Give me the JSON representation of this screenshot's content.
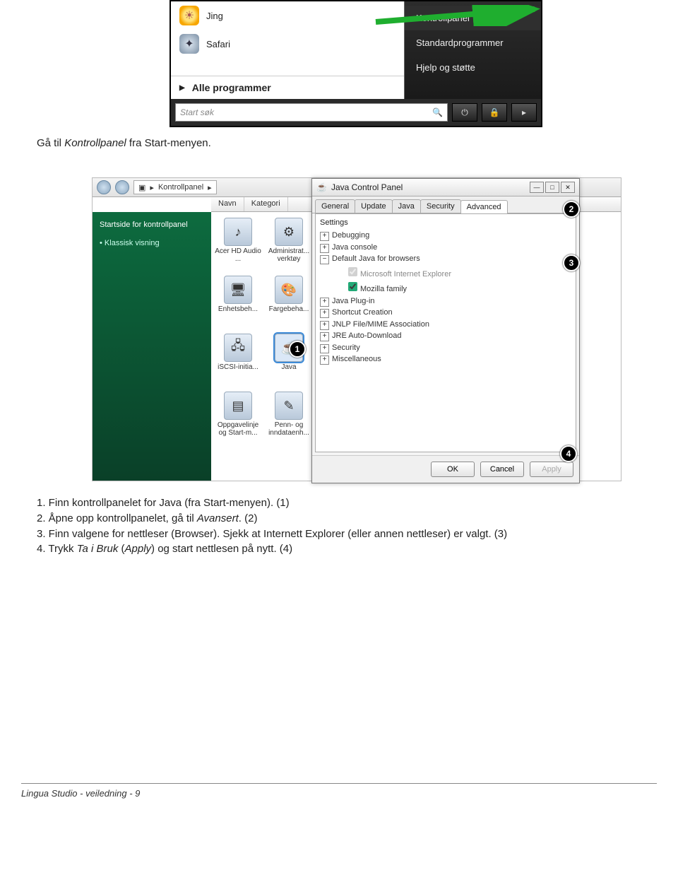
{
  "startmenu": {
    "left_items": [
      {
        "label": "Jing"
      },
      {
        "label": "Safari"
      }
    ],
    "all_programs": "Alle programmer",
    "right_items": [
      "Kontrollpanel",
      "Standardprogrammer",
      "Hjelp og støtte"
    ],
    "search_placeholder": "Start søk"
  },
  "caption1_pre": "Gå til ",
  "caption1_em": "Kontrollpanel",
  "caption1_post": " fra Start-menyen.",
  "cp": {
    "breadcrumb": "Kontrollpanel",
    "col1": "Navn",
    "col2": "Kategori",
    "sidebar_task": "Startside for kontrollpanel",
    "sidebar_link": "Klassisk visning",
    "icons": [
      "Acer HD Audio ...",
      "Administrat... verktøy",
      "Enhetsbeh...",
      "Fargebeha...",
      "iSCSI-initia...",
      "Java",
      "Oppgavelinje og Start-m...",
      "Penn- og inndataenh..."
    ]
  },
  "jcp": {
    "title": "Java Control Panel",
    "tabs": [
      "General",
      "Update",
      "Java",
      "Security",
      "Advanced"
    ],
    "active_tab": "Advanced",
    "settings_label": "Settings",
    "tree": [
      {
        "pm": "+",
        "label": "Debugging"
      },
      {
        "pm": "+",
        "label": "Java console"
      },
      {
        "pm": "−",
        "label": "Default Java for browsers",
        "children": [
          {
            "checked": true,
            "dim": true,
            "label": "Microsoft Internet Explorer"
          },
          {
            "checked": true,
            "label": "Mozilla family"
          }
        ]
      },
      {
        "pm": "+",
        "label": "Java Plug-in"
      },
      {
        "pm": "+",
        "label": "Shortcut Creation"
      },
      {
        "pm": "+",
        "label": "JNLP File/MIME Association"
      },
      {
        "pm": "+",
        "label": "JRE Auto-Download"
      },
      {
        "pm": "+",
        "label": "Security"
      },
      {
        "pm": "+",
        "label": "Miscellaneous"
      }
    ],
    "ok": "OK",
    "cancel": "Cancel",
    "apply": "Apply"
  },
  "instructions": {
    "l1": "1. Finn kontrollpanelet for Java (fra Start-menyen). (1)",
    "l2a": "2. Åpne opp kontrollpanelet, gå til ",
    "l2em": "Avansert",
    "l2b": ". (2)",
    "l3": "3. Finn valgene for nettleser (Browser). Sjekk at Internett Explorer (eller annen nettleser) er valgt. (3)",
    "l4a": "4. Trykk ",
    "l4em": "Ta i Bruk",
    "l4b": " (",
    "l4em2": "Apply",
    "l4c": ") og start nettlesen på nytt. (4)"
  },
  "footer": "Lingua Studio - veiledning - 9"
}
